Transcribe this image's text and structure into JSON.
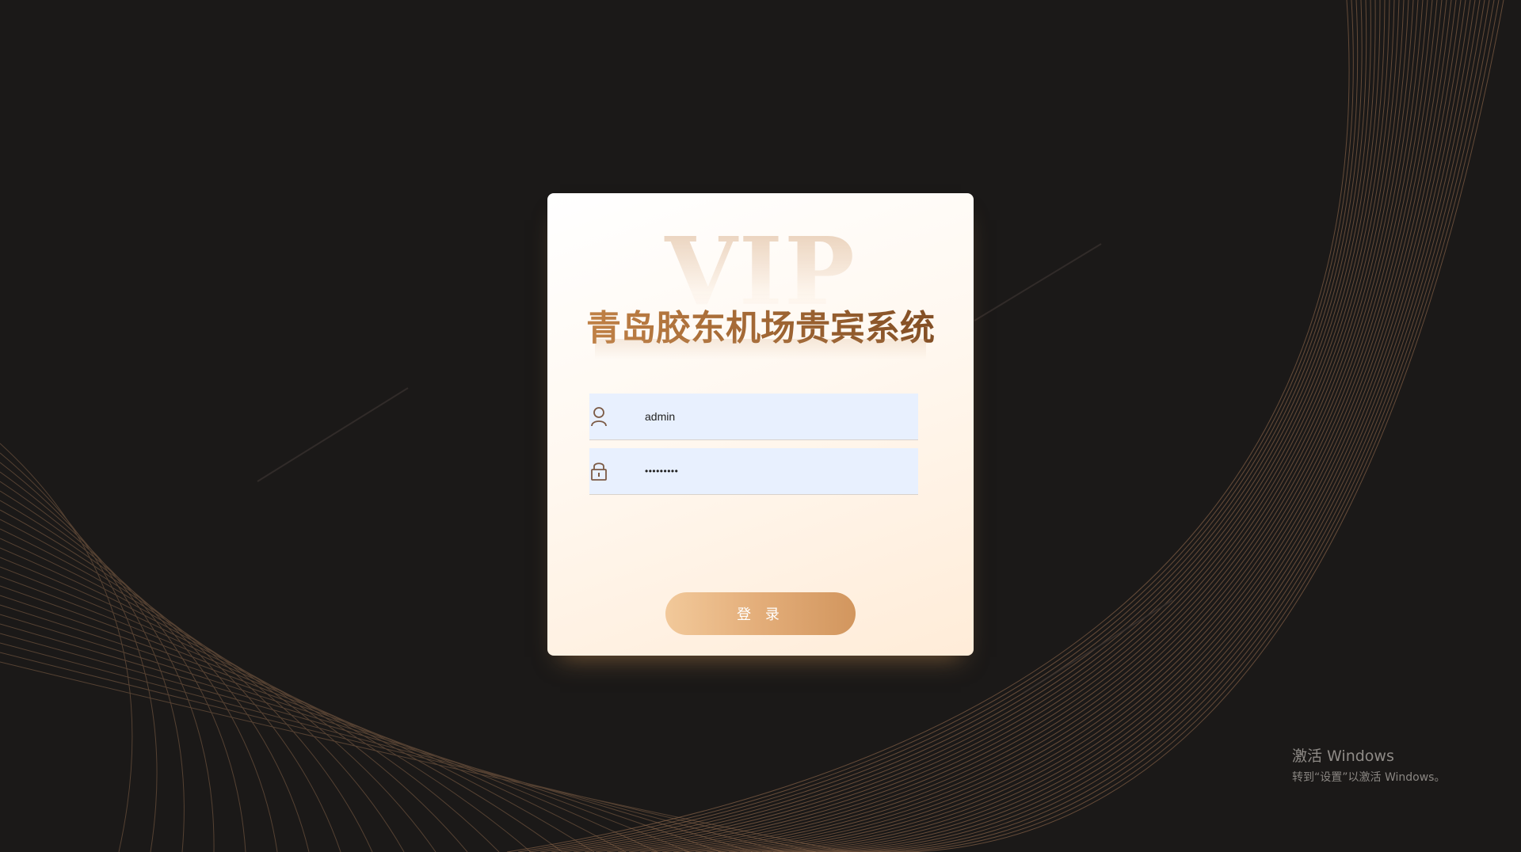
{
  "login": {
    "watermark": "VIP",
    "title": "青岛胶东机场贵宾系统",
    "username": {
      "value": "admin",
      "icon": "user-icon"
    },
    "password": {
      "value": "•••••••••",
      "icon": "lock-icon"
    },
    "submit_label": "登 录"
  },
  "windows_activation": {
    "title": "激活 Windows",
    "subtitle": "转到“设置”以激活 Windows。"
  },
  "colors": {
    "background": "#1b1918",
    "line_gold": "#b08058",
    "title_gold": "#a56a36",
    "button_start": "#f2c99a",
    "button_end": "#d2965e",
    "input_fill": "#e8f0fe"
  }
}
